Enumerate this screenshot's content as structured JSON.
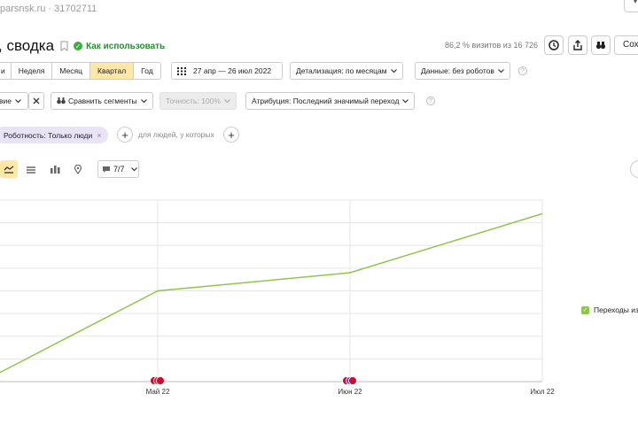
{
  "header": {
    "counter_line": "parsnsk.ru · 31702711",
    "title": ", сводка",
    "how_to_use": "Как использовать",
    "visits_info": "86,2 % визитов из 16 726",
    "save_label": "Сохр"
  },
  "period": {
    "segments": [
      {
        "label": "и",
        "active": false
      },
      {
        "label": "Неделя",
        "active": false
      },
      {
        "label": "Месяц",
        "active": false
      },
      {
        "label": "Квартал",
        "active": true
      },
      {
        "label": "Год",
        "active": false
      }
    ],
    "date_range": "27 апр — 26 июл 2022",
    "detail": "Детализация: по месяцам",
    "data_filter": "Данные: без роботов"
  },
  "toolbar2": {
    "left_select": "вие",
    "compare": "Сравнить сегменты",
    "accuracy": "Точность:  100%",
    "attribution": "Атрибуция: Последний значимый переход"
  },
  "filters": {
    "chip": "Роботность: Только люди",
    "people_text": "для людей, у которых"
  },
  "chart_controls": {
    "notes_count": "7/7"
  },
  "icons": {
    "history": "clock-icon",
    "export": "share-icon",
    "compare": "binoculars-icon",
    "calendar": "calendar-icon"
  },
  "colors": {
    "accent_active": "#ffe7a8",
    "line": "#8fc64a",
    "chip_bg": "#e8e3f7",
    "link_green": "#2a8a30"
  },
  "chart_data": {
    "type": "line",
    "categories": [
      "",
      "Май 22",
      "Июн 22",
      "Июл 22"
    ],
    "series": [
      {
        "name": "Переходы из",
        "values": [
          2,
          40,
          48,
          74
        ]
      }
    ],
    "ylim": [
      0,
      80
    ],
    "grid": true,
    "legend_position": "right"
  }
}
